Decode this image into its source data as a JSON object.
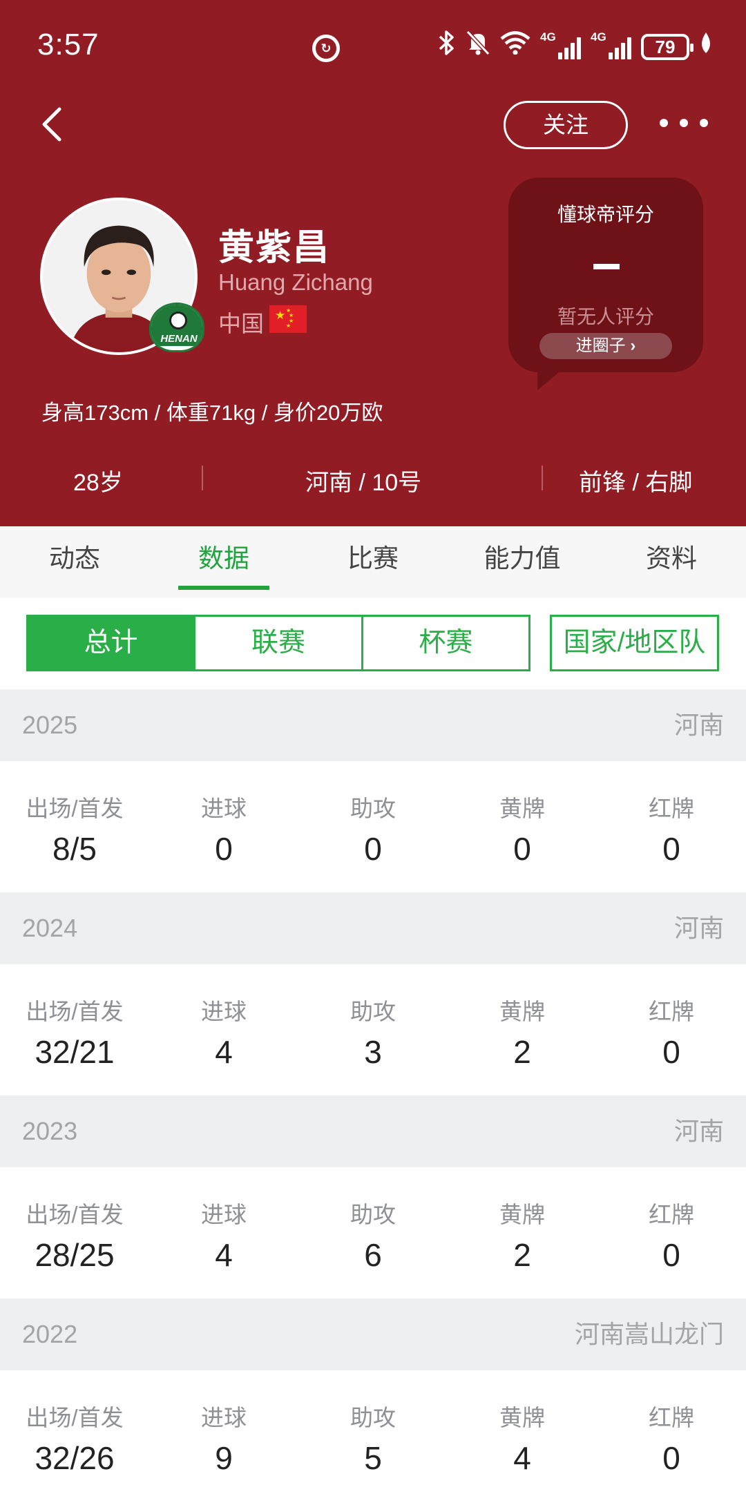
{
  "status_bar": {
    "time": "3:57",
    "center_icon": "app-notification-icon",
    "network_labels": [
      "4G",
      "4G"
    ],
    "battery": "79",
    "icons": [
      "bluetooth-icon",
      "mute-bell-icon",
      "wifi-icon",
      "signal-icon",
      "signal-icon",
      "battery-icon",
      "leaf-icon"
    ]
  },
  "header": {
    "follow_label": "关注",
    "player": {
      "name": "黄紫昌",
      "name_en": "Huang Zichang",
      "country": "中国",
      "bio": "身高173cm / 体重71kg / 身价20万欧",
      "badge_text": "HENAN"
    },
    "rating": {
      "title": "懂球帝评分",
      "value": "-",
      "empty_text": "暂无人评分",
      "button_label": "进圈子"
    },
    "info": {
      "age": "28岁",
      "club_number": "河南 / 10号",
      "position_foot": "前锋 / 右脚"
    }
  },
  "tabs": [
    {
      "label": "动态"
    },
    {
      "label": "数据"
    },
    {
      "label": "比赛"
    },
    {
      "label": "能力值"
    },
    {
      "label": "资料"
    }
  ],
  "active_tab": "数据",
  "filters": {
    "items": [
      {
        "label": "总计"
      },
      {
        "label": "联赛"
      },
      {
        "label": "杯赛"
      }
    ],
    "national": "国家/地区队"
  },
  "stat_labels": [
    "出场/首发",
    "进球",
    "助攻",
    "黄牌",
    "红牌"
  ],
  "seasons": [
    {
      "year": "2025",
      "team": "河南",
      "values": [
        "8/5",
        "0",
        "0",
        "0",
        "0"
      ]
    },
    {
      "year": "2024",
      "team": "河南",
      "values": [
        "32/21",
        "4",
        "3",
        "2",
        "0"
      ]
    },
    {
      "year": "2023",
      "team": "河南",
      "values": [
        "28/25",
        "4",
        "6",
        "2",
        "0"
      ]
    },
    {
      "year": "2022",
      "team": "河南嵩山龙门",
      "values": [
        "32/26",
        "9",
        "5",
        "4",
        "0"
      ]
    }
  ],
  "colors": {
    "header_bg": "#921C24",
    "rating_card_bg": "#6E1218",
    "accent_green": "#2AAE47"
  }
}
